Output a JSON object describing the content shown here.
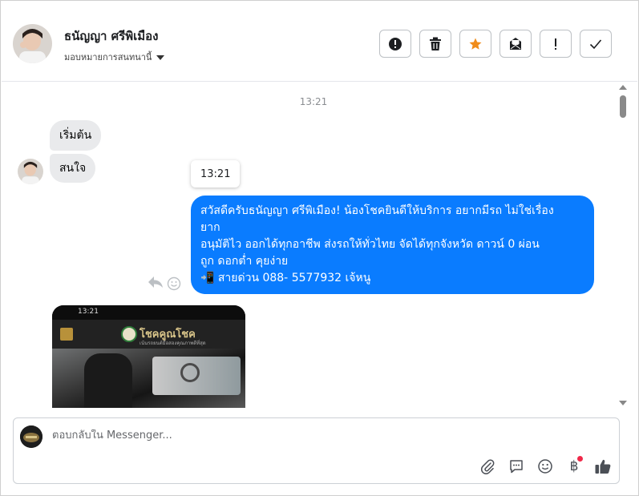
{
  "header": {
    "contact_name": "ธนัญญา ศรีพิเมือง",
    "assign_label": "มอบหมายการสนทนานี้",
    "actions": [
      {
        "name": "report",
        "icon": "exclamation-circle-icon"
      },
      {
        "name": "delete",
        "icon": "trash-icon"
      },
      {
        "name": "star",
        "icon": "star-icon",
        "color": "#f08c1a"
      },
      {
        "name": "mark-unread",
        "icon": "envelope-icon"
      },
      {
        "name": "follow-up",
        "icon": "exclamation-icon"
      },
      {
        "name": "done",
        "icon": "check-icon"
      }
    ]
  },
  "chat": {
    "timestamp": "13:21",
    "incoming": [
      {
        "text": "เริ่มต้น"
      },
      {
        "text": "สนใจ"
      }
    ],
    "tooltip_time": "13:21",
    "outgoing": {
      "lines": [
        "สวัสดีครับธนัญญา ศรีพิเมือง! น้องโชคยินดีให้บริการ อยากมีรถ ไม่ใช่เรื่อง",
        "ยาก",
        "อนุมัติไว ออกได้ทุกอาชีพ ส่งรถให้ทั่วไทย จัดได้ทุกจังหวัด ดาวน์ 0  ผ่อน",
        "ถูก ดอกต่ำ คุยง่าย",
        "📲 สายด่วน 088- 5577932 เจ้หนู"
      ],
      "bubble_color": "#0a7cff"
    },
    "attachment": {
      "status_time": "13:21",
      "site_name": "โชคคูณโชค",
      "site_tagline": "เน้นรถยนต์มือสองคุณภาพดีที่สุด"
    }
  },
  "composer": {
    "placeholder": "ตอบกลับใน Messenger...",
    "value": "",
    "tools": [
      {
        "name": "attach",
        "icon": "paperclip-icon"
      },
      {
        "name": "saved-replies",
        "icon": "chat-bubble-icon"
      },
      {
        "name": "emoji",
        "icon": "smiley-icon"
      },
      {
        "name": "payment",
        "icon": "baht-icon",
        "glyph": "฿"
      },
      {
        "name": "like",
        "icon": "thumbs-up-icon"
      }
    ]
  }
}
